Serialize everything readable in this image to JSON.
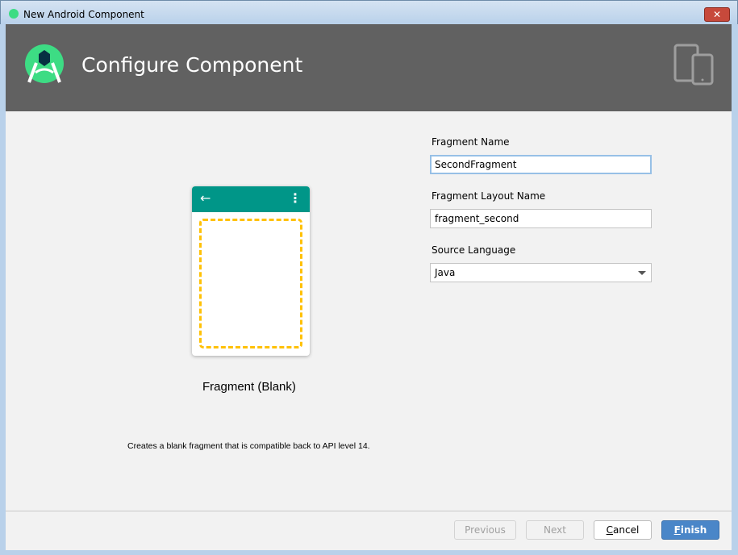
{
  "window": {
    "title": "New Android Component",
    "close_icon": "close-icon"
  },
  "header": {
    "title": "Configure Component"
  },
  "preview": {
    "template_name": "Fragment (Blank)",
    "description": "Creates a blank fragment that is compatible back to API level 14.",
    "accent": "#009688"
  },
  "form": {
    "fragment_name": {
      "label": "Fragment Name",
      "value": "SecondFragment"
    },
    "layout_name": {
      "label": "Fragment Layout Name",
      "value": "fragment_second"
    },
    "language": {
      "label": "Source Language",
      "value": "Java"
    }
  },
  "buttons": {
    "previous": "Previous",
    "next": "Next",
    "cancel_mnemonic": "C",
    "cancel_rest": "ancel",
    "finish_mnemonic": "F",
    "finish_rest": "inish"
  }
}
